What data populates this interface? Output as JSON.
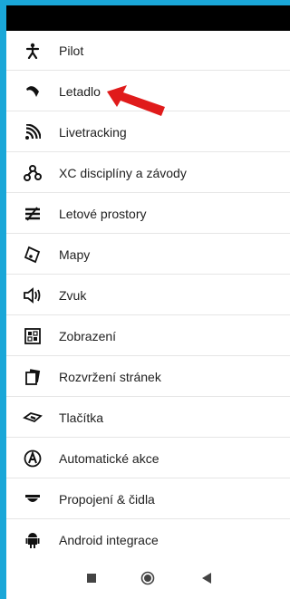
{
  "menu": {
    "items": [
      {
        "label": "Pilot",
        "icon": "pilot-icon"
      },
      {
        "label": "Letadlo",
        "icon": "glider-icon"
      },
      {
        "label": "Livetracking",
        "icon": "livetracking-icon"
      },
      {
        "label": "XC disciplíny a závody",
        "icon": "route-icon"
      },
      {
        "label": "Letové prostory",
        "icon": "airspace-icon"
      },
      {
        "label": "Mapy",
        "icon": "map-icon"
      },
      {
        "label": "Zvuk",
        "icon": "sound-icon"
      },
      {
        "label": "Zobrazení",
        "icon": "display-icon"
      },
      {
        "label": "Rozvržení stránek",
        "icon": "pages-icon"
      },
      {
        "label": "Tlačítka",
        "icon": "buttons-icon"
      },
      {
        "label": "Automatické akce",
        "icon": "auto-action-icon"
      },
      {
        "label": "Propojení & čidla",
        "icon": "sensor-icon"
      },
      {
        "label": "Android integrace",
        "icon": "android-icon"
      }
    ]
  },
  "colors": {
    "frame": "#1aa7d8",
    "arrow": "#e01b1b",
    "text": "#212121"
  },
  "nav": {
    "buttons": [
      "stop-icon",
      "home-icon",
      "back-icon"
    ]
  }
}
